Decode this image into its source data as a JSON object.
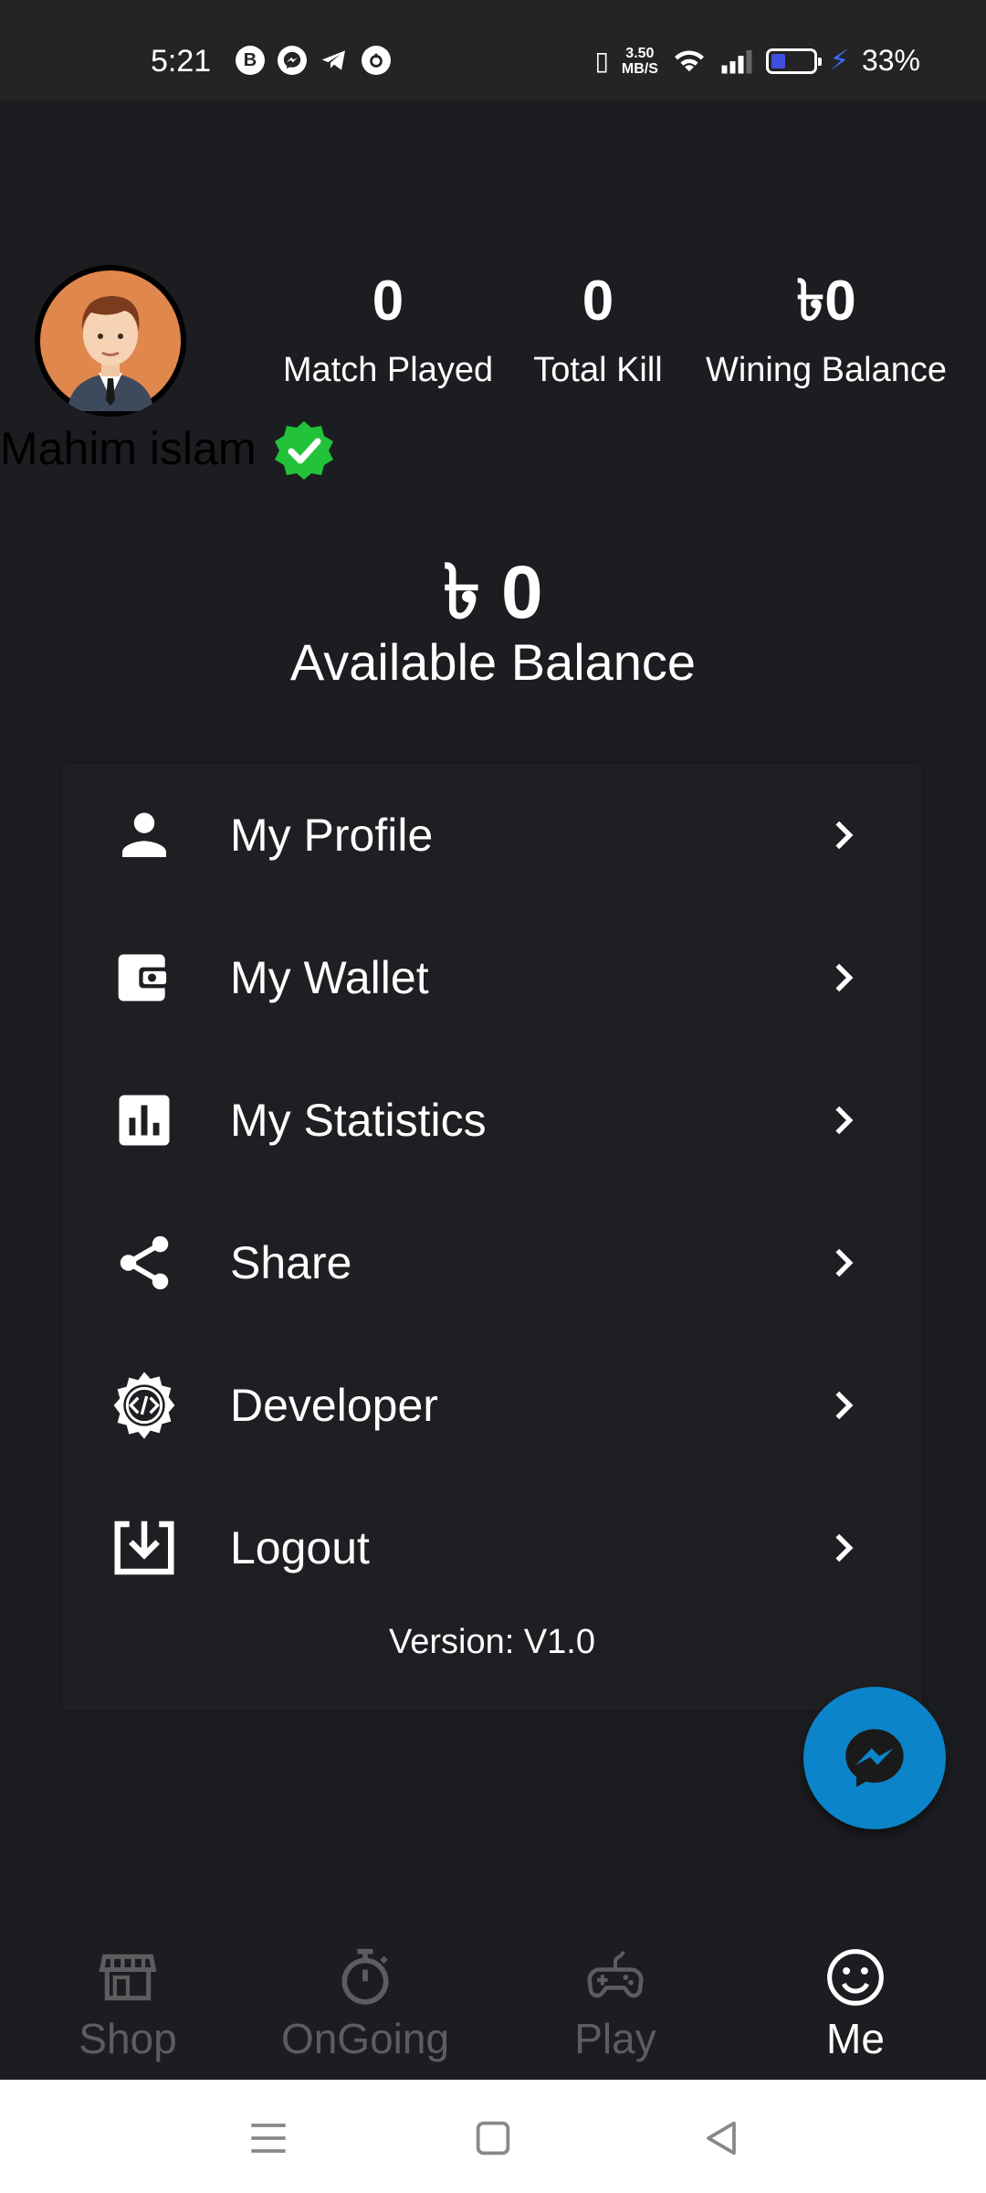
{
  "status_bar": {
    "time": "5:21",
    "speed_top": "3.50",
    "speed_unit": "MB/S",
    "battery": "33%",
    "battery_level": 0.33,
    "left_icons": [
      "b-icon",
      "messenger-icon",
      "telegram-icon",
      "notification-app-icon"
    ]
  },
  "profile": {
    "name": "Mahim islam",
    "stats": [
      {
        "value": "0",
        "label": "Match Played"
      },
      {
        "value": "0",
        "label": "Total Kill"
      },
      {
        "value": "৳0",
        "label": "Wining Balance"
      }
    ],
    "balance_amount": "৳ 0",
    "balance_label": "Available Balance"
  },
  "menu": {
    "items": [
      {
        "label": "My Profile",
        "icon": "person-icon"
      },
      {
        "label": "My Wallet",
        "icon": "wallet-icon"
      },
      {
        "label": "My Statistics",
        "icon": "bar-chart-icon"
      },
      {
        "label": "Share",
        "icon": "share-icon"
      },
      {
        "label": "Developer",
        "icon": "developer-gear-icon"
      },
      {
        "label": "Logout",
        "icon": "download-box-icon"
      }
    ],
    "version": "Version: V1.0"
  },
  "bottom_nav": {
    "items": [
      {
        "label": "Shop",
        "icon": "store-icon",
        "active": false
      },
      {
        "label": "OnGoing",
        "icon": "stopwatch-icon",
        "active": false
      },
      {
        "label": "Play",
        "icon": "gamepad-icon",
        "active": false
      },
      {
        "label": "Me",
        "icon": "smiley-icon",
        "active": true
      }
    ]
  },
  "colors": {
    "background": "#1c1d20",
    "fab": "#0b84c9",
    "verified": "#22c33a",
    "inactive_nav": "#5d5d5f"
  }
}
